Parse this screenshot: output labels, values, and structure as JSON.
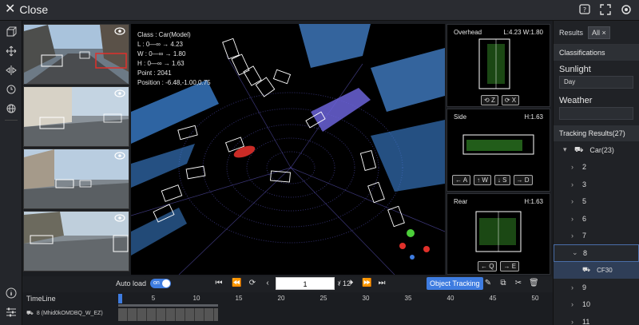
{
  "topbar": {
    "close_label": "Close"
  },
  "view3d": {
    "info": {
      "class_line": "Class : Car(Model)",
      "l_line": "L : 0—∞ → 4.23",
      "w_line": "W : 0—∞ → 1.80",
      "h_line": "H : 0—∞ → 1.63",
      "point_line": "Point : 2041",
      "position_line": "Position : -6.48,-1.00,0.75"
    }
  },
  "sideviews": {
    "overhead": {
      "title": "Overhead",
      "meta": "L:4.23 W:1.80",
      "buttons": [
        "Z",
        "X"
      ]
    },
    "side": {
      "title": "Side",
      "meta": "H:1.63",
      "buttons": [
        "A",
        "W",
        "S",
        "D"
      ]
    },
    "rear": {
      "title": "Rear",
      "meta": "H:1.63",
      "buttons": [
        "Q",
        "E"
      ]
    }
  },
  "rpanel": {
    "results_label": "Results",
    "results_chip": "All ×",
    "classifications_header": "Classifications",
    "sunlight_label": "Sunlight",
    "sunlight_value": "Day",
    "weather_label": "Weather",
    "tracking_header": "Tracking Results(27)",
    "car_group": "Car(23)",
    "items": [
      "2",
      "3",
      "5",
      "6",
      "7",
      "8",
      "9",
      "10",
      "11"
    ],
    "child_item": "CF30"
  },
  "controls": {
    "autoload_label": "Auto load",
    "toggle_label": "on",
    "page_value": "1",
    "page_total": "/ 12",
    "object_tracking_label": "Object Tracking"
  },
  "timeline": {
    "label": "TimeLine",
    "ticks": [
      "1",
      "5",
      "10",
      "15",
      "20",
      "25",
      "30",
      "35",
      "40",
      "45",
      "50"
    ],
    "track_label": "8 (Mhid0kOMDBQ_W_EZ)"
  },
  "colors": {
    "accent": "#3e7ce0",
    "panel": "#202226",
    "lidar_blue": "#4a8fe0",
    "lidar_purple": "#6b63d8",
    "highlight_red": "#e0302a",
    "green_points": "#4ccf3a"
  }
}
